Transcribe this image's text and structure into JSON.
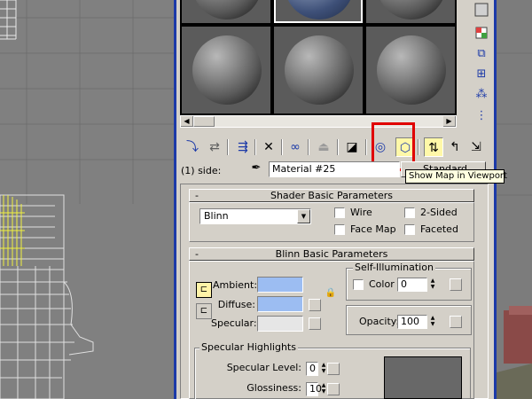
{
  "toolbar": {
    "tooltip": "Show Map in Viewport"
  },
  "side_label": "(1) side:",
  "material_name": "Material #25",
  "material_type": "Standard",
  "shader_rollout": {
    "title": "Shader Basic Parameters",
    "collapse": "-",
    "shader": "Blinn",
    "wire": "Wire",
    "two_sided": "2-Sided",
    "face_map": "Face Map",
    "faceted": "Faceted"
  },
  "blinn_rollout": {
    "title": "Blinn Basic Parameters",
    "collapse": "-",
    "ambient_label": "Ambient:",
    "diffuse_label": "Diffuse:",
    "specular_label": "Specular:",
    "ambient_color": "#9cbdf2",
    "diffuse_color": "#9cbdf2",
    "specular_color": "#e6e6e6",
    "self_illum_title": "Self-Illumination",
    "color_label": "Color",
    "color_value": "0",
    "opacity_label": "Opacity:",
    "opacity_value": "100",
    "spec_highlights_title": "Specular Highlights",
    "spec_level_label": "Specular Level:",
    "spec_level_value": "0",
    "glossiness_label": "Glossiness:",
    "glossiness_value": "10"
  },
  "icons": [
    "get-material-icon",
    "put-to-scene-icon",
    "assign-material-icon",
    "reset-icon",
    "make-unique-icon",
    "put-to-library-icon",
    "material-effects-channel-icon",
    "show-map-in-viewport-icon",
    "show-end-result-icon",
    "go-to-parent-icon",
    "go-forward-to-sibling-icon",
    "pick-material-eyedropper-icon",
    "lock-icon"
  ],
  "colors": {
    "window_border": "#1c3aa8",
    "highlight_box": "#e00000",
    "panel_bg": "#d4d0c8",
    "tooltip_bg": "#ffffe1"
  }
}
